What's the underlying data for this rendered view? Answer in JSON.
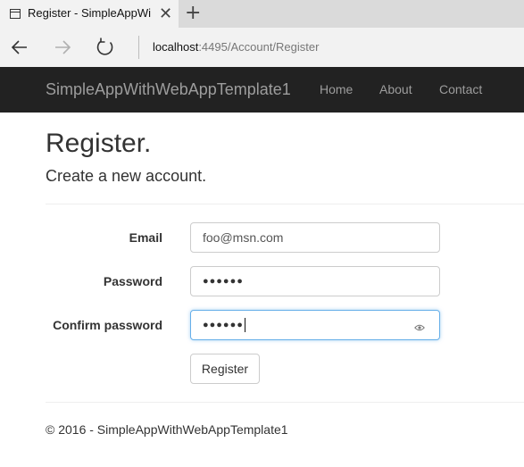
{
  "browser": {
    "tab_title": "Register - SimpleAppWi",
    "address_host": "localhost",
    "address_rest": ":4495/Account/Register"
  },
  "navbar": {
    "brand": "SimpleAppWithWebAppTemplate1",
    "links": [
      "Home",
      "About",
      "Contact"
    ]
  },
  "page": {
    "title": "Register.",
    "subtitle": "Create a new account."
  },
  "form": {
    "email_label": "Email",
    "email_value": "foo@msn.com",
    "password_label": "Password",
    "password_value": "●●●●●●",
    "confirm_label": "Confirm password",
    "confirm_value": "●●●●●●",
    "submit_label": "Register"
  },
  "footer": {
    "text": "© 2016 - SimpleAppWithWebAppTemplate1"
  },
  "colors": {
    "navbar_bg": "#222222",
    "navbar_text": "#9d9d9d",
    "focus_border": "#66afe9"
  },
  "icons": [
    "page-icon",
    "close-icon",
    "plus-icon",
    "back-arrow-icon",
    "forward-arrow-icon",
    "refresh-icon",
    "eye-icon"
  ]
}
